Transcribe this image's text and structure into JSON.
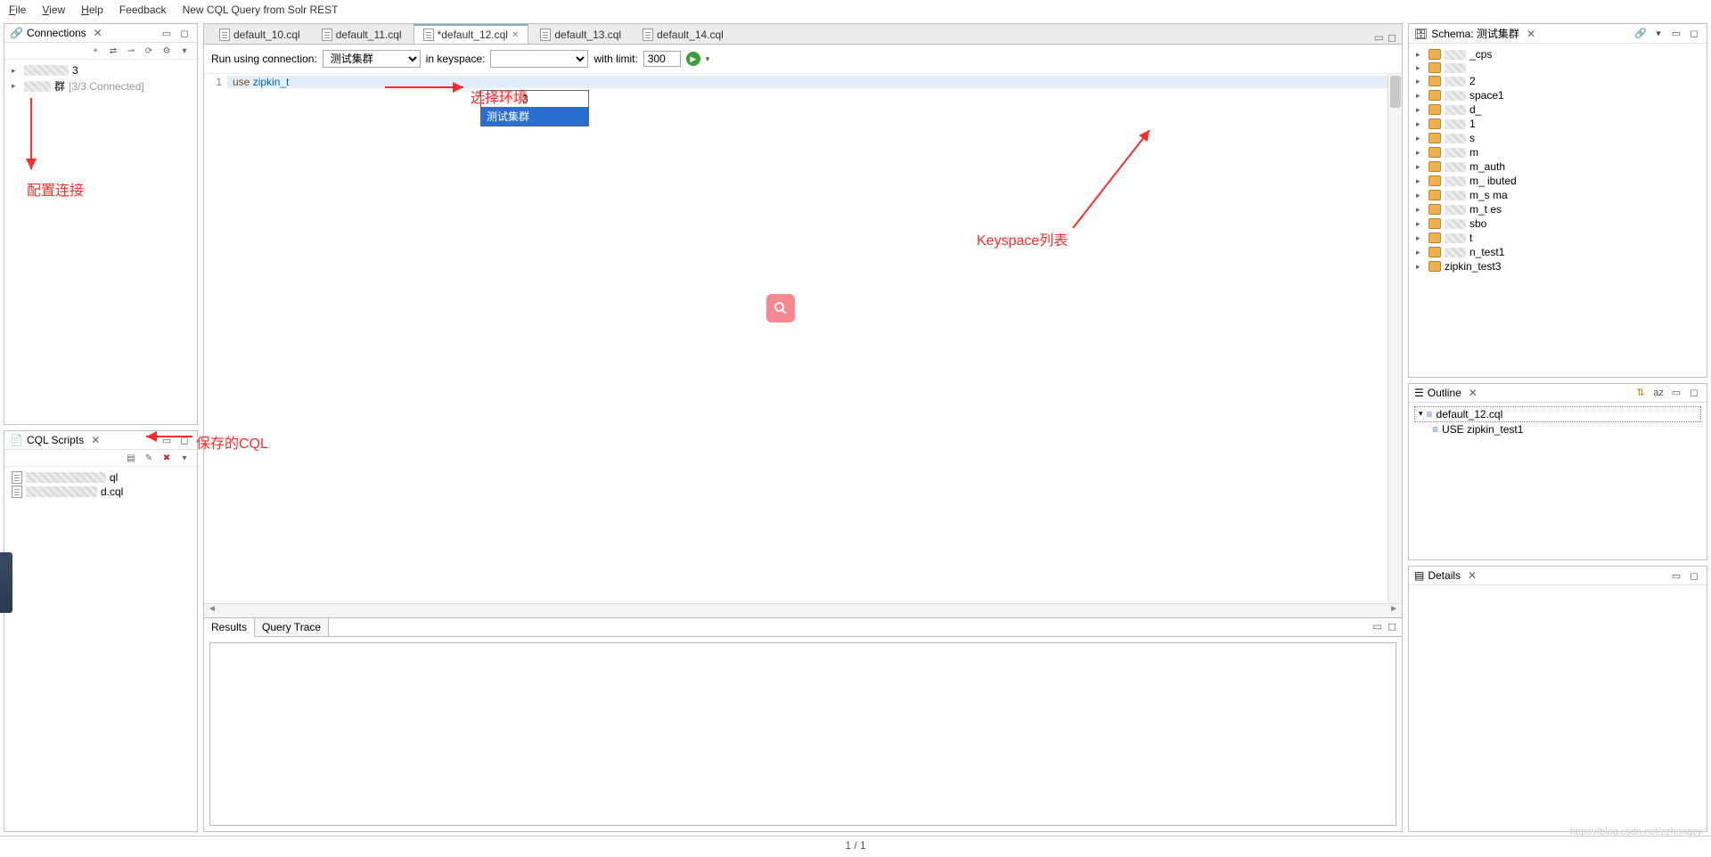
{
  "menubar": [
    "File",
    "View",
    "Help",
    "Feedback",
    "New CQL Query from Solr REST"
  ],
  "connections": {
    "title": "Connections",
    "items": [
      {
        "label": "3",
        "blurred": true
      },
      {
        "label": "群",
        "suffix": "[3/3 Connected]",
        "blurred": true
      }
    ]
  },
  "cql_scripts": {
    "title": "CQL Scripts",
    "toolbar_icons": [
      "new",
      "edit",
      "delete",
      "menu"
    ],
    "items": [
      {
        "label": "",
        "suffix": "ql",
        "blurred": true
      },
      {
        "label": "",
        "suffix": "d.cql",
        "blurred": true
      }
    ]
  },
  "editor": {
    "tabs": [
      {
        "label": "default_10.cql",
        "active": false,
        "closable": false
      },
      {
        "label": "default_11.cql",
        "active": false,
        "closable": false
      },
      {
        "label": "*default_12.cql",
        "active": true,
        "closable": true
      },
      {
        "label": "default_13.cql",
        "active": false,
        "closable": false
      },
      {
        "label": "default_14.cql",
        "active": false,
        "closable": false
      }
    ],
    "run_label": "Run using connection:",
    "connection_value": "测试集群",
    "keyspace_label": "in keyspace:",
    "keyspace_value": "",
    "limit_label": "with limit:",
    "limit_value": "300",
    "code_line1_kw": "use",
    "code_line1_ident": "zipkin_t",
    "dropdown": {
      "opt1": "3",
      "opt2": "测试集群"
    }
  },
  "results": {
    "tabs": [
      "Results",
      "Query Trace"
    ]
  },
  "schema": {
    "title": "Schema: 测试集群",
    "items": [
      {
        "label": "_cps",
        "blurred": true
      },
      {
        "label": "",
        "blurred": true
      },
      {
        "label": "2",
        "blurred": true
      },
      {
        "label": "space1",
        "blurred": true
      },
      {
        "label": "d_",
        "blurred": true
      },
      {
        "label": "1",
        "blurred": true
      },
      {
        "label": "s",
        "blurred": true
      },
      {
        "label": "m",
        "blurred": true
      },
      {
        "label": "m_auth",
        "blurred": true
      },
      {
        "label": "m_   ibuted",
        "blurred": true
      },
      {
        "label": "m_s    ma",
        "blurred": true
      },
      {
        "label": "m_t    es",
        "blurred": true
      },
      {
        "label": "sbo",
        "blurred": true
      },
      {
        "label": "t",
        "blurred": true
      },
      {
        "label": "n_test1",
        "blurred": true
      },
      {
        "label": "zipkin_test3",
        "blurred": false
      }
    ]
  },
  "outline": {
    "title": "Outline",
    "root": "default_12.cql",
    "child": "USE zipkin_test1"
  },
  "details": {
    "title": "Details"
  },
  "statusbar": {
    "pos": "1 / 1"
  },
  "annotations": {
    "env": "选择环境",
    "conn": "配置连接",
    "cql": "保存的CQL",
    "ks": "Keyspace列表"
  },
  "watermark": "https://blog.csdn.net/zzhongcy"
}
